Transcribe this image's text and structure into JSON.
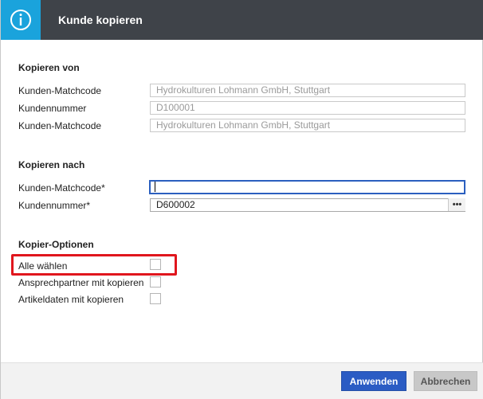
{
  "dialog": {
    "title": "Kunde kopieren",
    "icon": "info-icon",
    "accent_color": "#1aa3dc",
    "titlebar_color": "#3f4349"
  },
  "copy_from": {
    "heading": "Kopieren von",
    "rows": [
      {
        "label": "Kunden-Matchcode",
        "value": "Hydrokulturen Lohmann GmbH, Stuttgart"
      },
      {
        "label": "Kundennummer",
        "value": "D100001"
      },
      {
        "label": "Kunden-Matchcode",
        "value": "Hydrokulturen Lohmann GmbH, Stuttgart"
      }
    ]
  },
  "copy_to": {
    "heading": "Kopieren nach",
    "matchcode_label": "Kunden-Matchcode*",
    "matchcode_value": "",
    "number_label": "Kundennummer*",
    "number_value": "D600002",
    "lookup_button": "•••"
  },
  "options": {
    "heading": "Kopier-Optionen",
    "items": [
      {
        "label": "Alle wählen",
        "checked": false
      },
      {
        "label": "Ansprechpartner mit kopieren",
        "checked": false
      },
      {
        "label": "Artikeldaten mit kopieren",
        "checked": false
      }
    ],
    "highlight_color": "#e0161d"
  },
  "footer": {
    "apply_label": "Anwenden",
    "cancel_label": "Abbrechen",
    "primary_color": "#2b5cc4"
  }
}
